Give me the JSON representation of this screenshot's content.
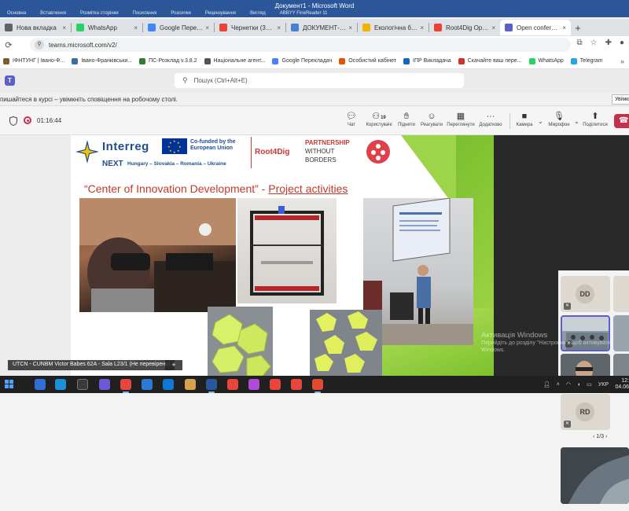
{
  "word": {
    "title": "Документ1 - Microsoft Word",
    "ribbon_tabs": [
      "Основна",
      "Вставлення",
      "Розмітка сторінки",
      "Посилання",
      "Розсилки",
      "Рецензування",
      "Вигляд",
      "ABBYY FineReader 11"
    ]
  },
  "browser": {
    "tabs": [
      {
        "label": "Нова вкладка",
        "color": "#5f6368",
        "active": false
      },
      {
        "label": "WhatsApp",
        "color": "#25d366",
        "active": false
      },
      {
        "label": "Google Перекладач",
        "color": "#4285f4",
        "active": false
      },
      {
        "label": "Чернетки (39) - ivan",
        "color": "#ea4335",
        "active": false
      },
      {
        "label": "ДОКУМЕНТ-001",
        "color": "#4a7fd4",
        "active": false
      },
      {
        "label": "Екологічна безпека",
        "color": "#f0b400",
        "active": false
      },
      {
        "label": "Root4Dig Open Call",
        "color": "#ea4335",
        "active": false
      },
      {
        "label": "Open conference",
        "color": "#5b5fc7",
        "active": true
      }
    ],
    "url": "teams.microsoft.com/v2/",
    "bookmarks": [
      {
        "label": "ІФНТУНГ | Івано-Ф...",
        "color": "#7b5c2e"
      },
      {
        "label": "Івано-Франківськи...",
        "color": "#3a6ea5"
      },
      {
        "label": "ПС-Розклад v.3.8.2",
        "color": "#2e7d32"
      },
      {
        "label": "Національне агент...",
        "color": "#555555"
      },
      {
        "label": "Google Перекладач",
        "color": "#4285f4"
      },
      {
        "label": "Особистий кабінет",
        "color": "#e65100"
      },
      {
        "label": "ІПР Викладача",
        "color": "#1565c0"
      },
      {
        "label": "Скачайте ваш пере...",
        "color": "#d32f2f"
      },
      {
        "label": "WhatsApp",
        "color": "#25d366"
      },
      {
        "label": "Telegram",
        "color": "#2aa3df"
      }
    ]
  },
  "teams": {
    "search_placeholder": "Пошук (Ctrl+Alt+E)",
    "banner_text": "пишайтеся в курсі – увімкніть сповіщення на робочому столі.",
    "banner_button": "Увімкнути",
    "timer": "01:16:44",
    "participants_count": "19",
    "tools": {
      "chat": "Чат",
      "people": "Користувачі",
      "raise": "Підняти",
      "react": "Реагувати",
      "rooms": "Переглянути",
      "more": "Додатково",
      "camera": "Камера",
      "mic": "Мікрофон",
      "share": "Поділитися"
    },
    "stage_caption": "UTCN - CUNBM Victor Babes 62A - Sala L23/1 (Не перевірено)",
    "pager": "1/3",
    "participants": [
      {
        "initials": "DD"
      },
      {
        "initials": ""
      },
      {
        "initials": ""
      },
      {
        "initials": "RD"
      }
    ]
  },
  "slide": {
    "interreg": "Interreg",
    "next": "NEXT",
    "countries": "Hungary – Slovakia – Romania – Ukraine",
    "cofunded": "Co-funded by the European Union",
    "root4dig": "Root4Dig",
    "partnership": "PARTNERSHIP",
    "without": "WITHOUT",
    "borders": "BORDERS",
    "title_prefix": "“Center of Innovation Development” - ",
    "title_link": "Project activities"
  },
  "os": {
    "activation_title": "Активація Windows",
    "activation_text": "Перейдіть до розділу \"Настройки\", щоб активувати Windows.",
    "tray_lang": "УКР",
    "clock_time": "12:",
    "clock_date": "04.06"
  }
}
